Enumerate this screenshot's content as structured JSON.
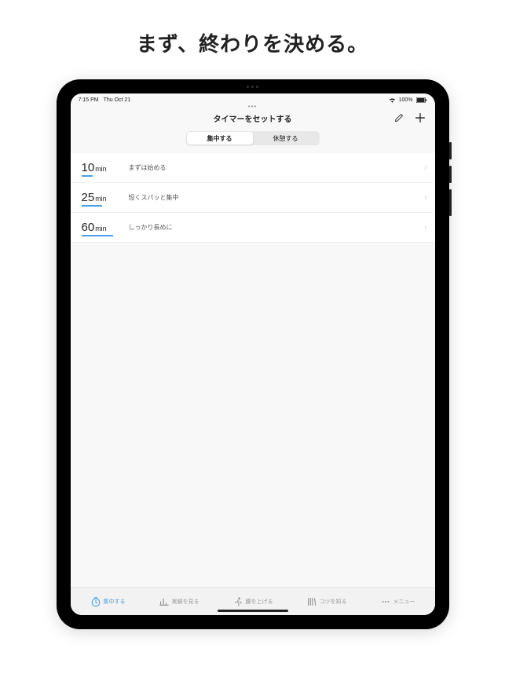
{
  "headline": "まず、終わりを決める。",
  "status": {
    "time": "7:15 PM",
    "date": "Thu Oct 21",
    "battery": "100%"
  },
  "nav": {
    "title": "タイマーをセットする",
    "dots": "•••"
  },
  "segments": [
    {
      "label": "集中する",
      "active": true
    },
    {
      "label": "休憩する",
      "active": false
    }
  ],
  "timers": [
    {
      "num": "10",
      "unit": "min",
      "label": "まずは始める",
      "underline_width": 14
    },
    {
      "num": "25",
      "unit": "min",
      "label": "短くスパッと集中",
      "underline_width": 26
    },
    {
      "num": "60",
      "unit": "min",
      "label": "しっかり長めに",
      "underline_width": 40
    }
  ],
  "tabs": [
    {
      "label": "集中する",
      "icon": "timer",
      "active": true
    },
    {
      "label": "実績を見る",
      "icon": "chart",
      "active": false
    },
    {
      "label": "腰を上げる",
      "icon": "run",
      "active": false
    },
    {
      "label": "コツを知る",
      "icon": "books",
      "active": false
    },
    {
      "label": "メニュー",
      "icon": "dots",
      "active": false
    }
  ]
}
